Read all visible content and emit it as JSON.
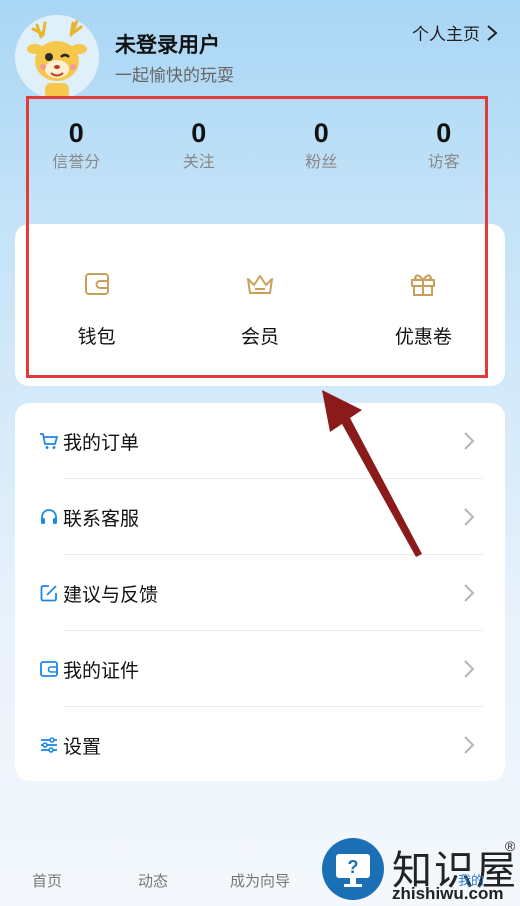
{
  "profile": {
    "name": "未登录用户",
    "subtitle": "一起愉快的玩耍",
    "homepage_link": "个人主页"
  },
  "stats": [
    {
      "value": "0",
      "label": "信誉分"
    },
    {
      "value": "0",
      "label": "关注"
    },
    {
      "value": "0",
      "label": "粉丝"
    },
    {
      "value": "0",
      "label": "访客"
    }
  ],
  "quick_actions": [
    {
      "label": "钱包",
      "icon": "wallet-icon"
    },
    {
      "label": "会员",
      "icon": "crown-icon"
    },
    {
      "label": "优惠卷",
      "icon": "gift-icon"
    }
  ],
  "menu": [
    {
      "label": "我的订单",
      "icon": "cart-icon"
    },
    {
      "label": "联系客服",
      "icon": "headset-icon"
    },
    {
      "label": "建议与反馈",
      "icon": "edit-icon"
    },
    {
      "label": "我的证件",
      "icon": "id-card-icon"
    },
    {
      "label": "设置",
      "icon": "sliders-icon"
    }
  ],
  "tabbar": {
    "home": "首页",
    "feed": "动态",
    "guide": "成为向导",
    "mine": "我的"
  },
  "watermark": {
    "title": "知识屋",
    "domain": "zhishiwu.com",
    "registered": "®"
  },
  "colors": {
    "accent_blue": "#1e88e5",
    "icon_gold": "#c9a05a",
    "annotation_red": "#e23b3b",
    "arrow_dark_red": "#8b1a1a"
  }
}
